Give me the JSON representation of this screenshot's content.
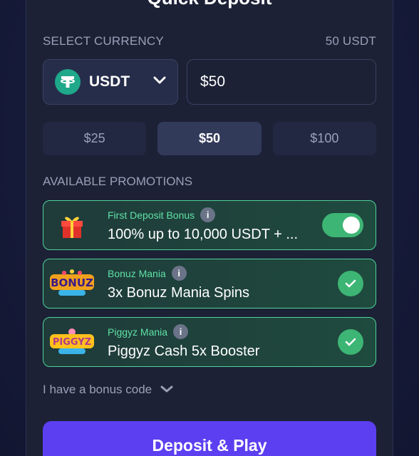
{
  "title": "Quick Deposit",
  "currency_section": {
    "label": "SELECT CURRENCY",
    "balance": "50 USDT",
    "selected_currency": "USDT",
    "amount_value": "$50"
  },
  "presets": [
    "$25",
    "$50",
    "$100"
  ],
  "active_preset": "$50",
  "promotions": {
    "heading": "AVAILABLE PROMOTIONS",
    "items": [
      {
        "tag": "First Deposit Bonus",
        "text": "100% up to 10,000 USDT + ...",
        "control": "toggle",
        "enabled": true
      },
      {
        "tag": "Bonuz Mania",
        "text": "3x Bonuz Mania Spins",
        "control": "check",
        "logo_text": "BONUZ"
      },
      {
        "tag": "Piggyz Mania",
        "text": "Piggyz Cash 5x Booster",
        "control": "check",
        "logo_text": "PIGGYZ"
      }
    ]
  },
  "bonus_code_label": "I have a bonus code",
  "cta_label": "Deposit & Play",
  "colors": {
    "accent_green": "#3db574",
    "promo_text_green": "#5fe1a6",
    "cta_purple": "#5b3ff0",
    "tether_green": "#1fa88a"
  },
  "icons": {
    "currency": "tether-icon",
    "dropdown": "chevron-down-icon",
    "info": "info-icon",
    "check": "check-icon",
    "gift": "gift-icon"
  }
}
